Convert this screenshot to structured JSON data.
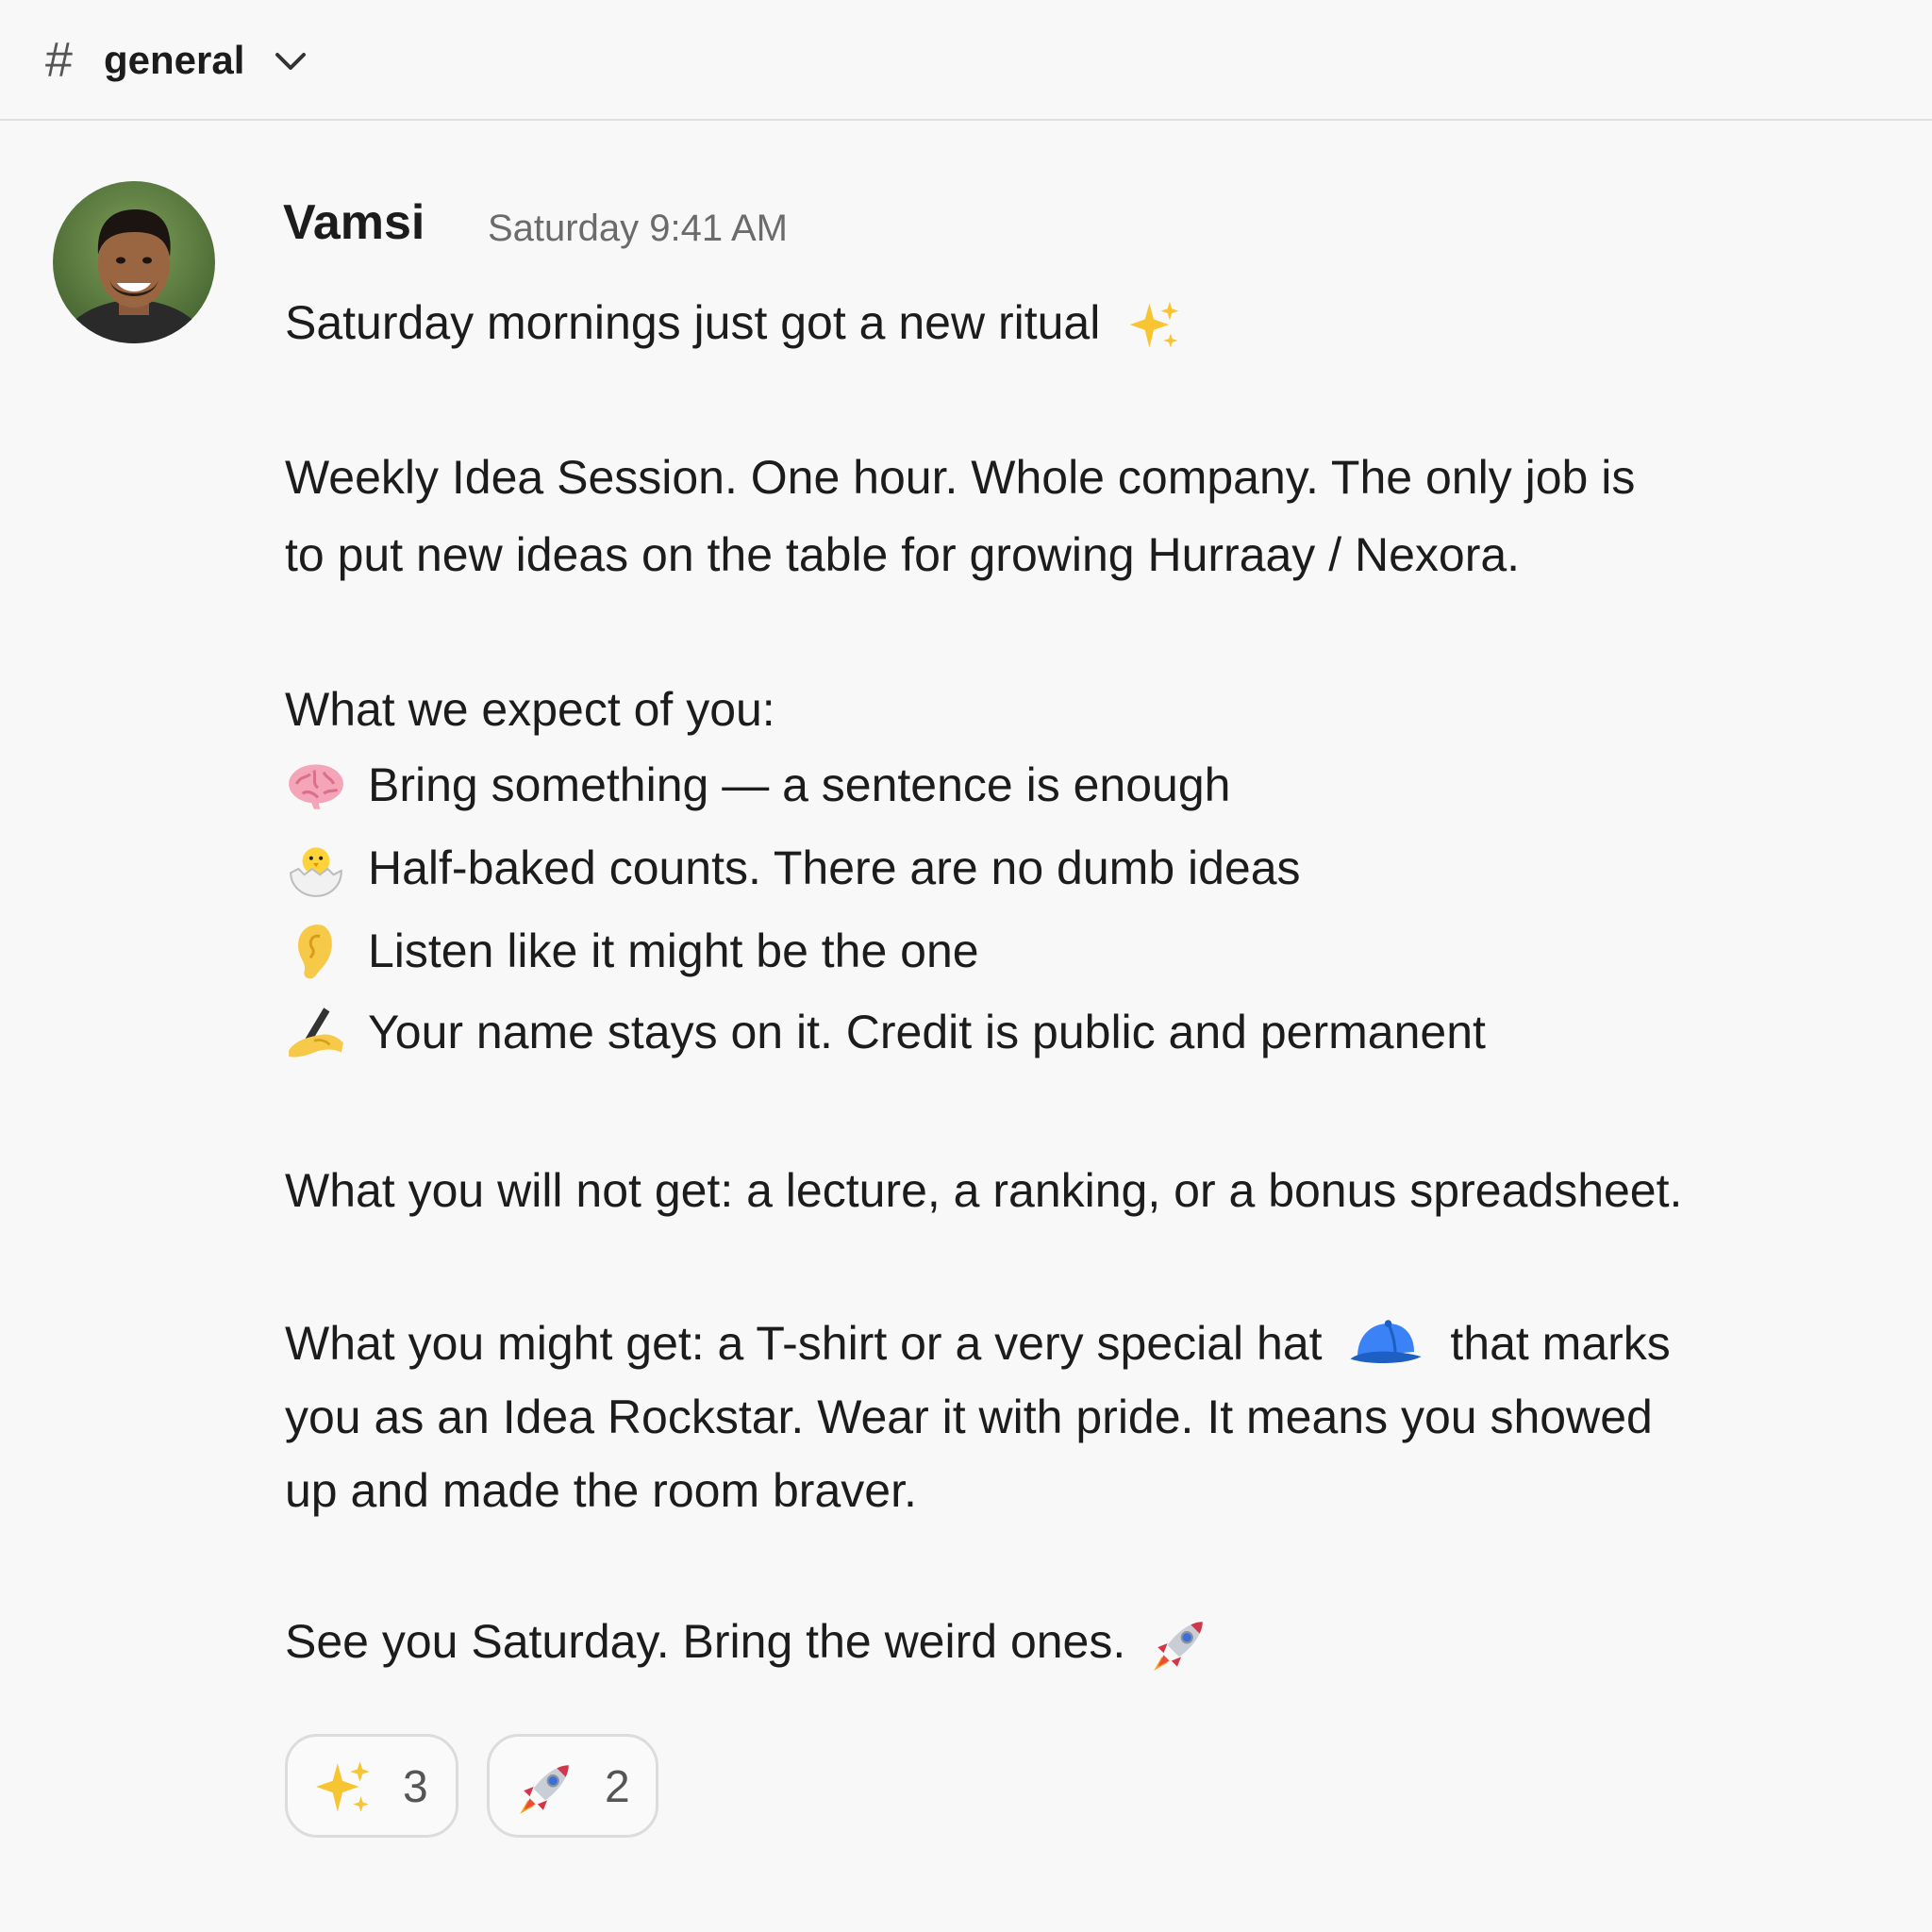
{
  "channel": {
    "hash": "#",
    "name": "general"
  },
  "message": {
    "author": "Vamsi",
    "timestamp": "Saturday 9:41 AM",
    "intro": "Saturday mornings just got a new ritual",
    "para1_line1": "Weekly Idea Session. One hour. Whole company. The only job is",
    "para1_line2": "to put new ideas on the table for growing Hurraay / Nexora.",
    "expect_heading": "What we expect of you:",
    "bullets": [
      {
        "icon": "brain-icon",
        "text": "Bring something — a sentence is enough"
      },
      {
        "icon": "hatching-chick-icon",
        "text": "Half-baked counts. There are no dumb ideas"
      },
      {
        "icon": "ear-icon",
        "text": "Listen like it might be the one"
      },
      {
        "icon": "writing-hand-icon",
        "text": "Your name stays on it. Credit is public and permanent"
      }
    ],
    "not_get": "What you will not get: a lecture, a ranking, or a bonus spreadsheet.",
    "might_get_line1a": "What you might get: a T-shirt or a very special hat",
    "might_get_line1b": "that marks",
    "might_get_line2": "you as an Idea Rockstar. Wear it with pride. It means you showed",
    "might_get_line3": "up and made the room braver.",
    "closing": "See you Saturday. Bring the weird ones."
  },
  "reactions": [
    {
      "icon": "sparkles-icon",
      "count": "3"
    },
    {
      "icon": "rocket-icon",
      "count": "2"
    }
  ]
}
